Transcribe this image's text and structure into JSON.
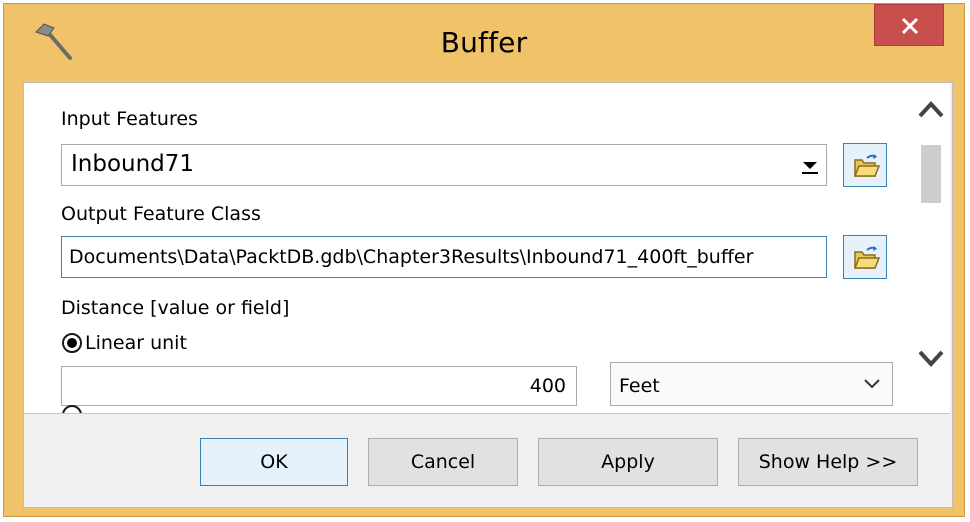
{
  "window": {
    "title": "Buffer"
  },
  "form": {
    "input_features": {
      "label": "Input Features",
      "value": "Inbound71"
    },
    "output_feature_class": {
      "label": "Output Feature Class",
      "value": "Documents\\Data\\PacktDB.gdb\\Chapter3Results\\Inbound71_400ft_buffer"
    },
    "distance": {
      "label": "Distance [value or field]",
      "linear_unit_label": "Linear unit",
      "value": "400",
      "unit": "Feet"
    }
  },
  "buttons": {
    "ok": "OK",
    "cancel": "Cancel",
    "apply": "Apply",
    "help": "Show Help >>"
  },
  "colors": {
    "titlebar": "#f0c26a",
    "close": "#c94f4f",
    "focus_border": "#3c7fb1"
  },
  "icons": [
    "hammer-icon",
    "close-icon",
    "folder-open-icon",
    "chevron-up-icon",
    "chevron-down-icon"
  ]
}
